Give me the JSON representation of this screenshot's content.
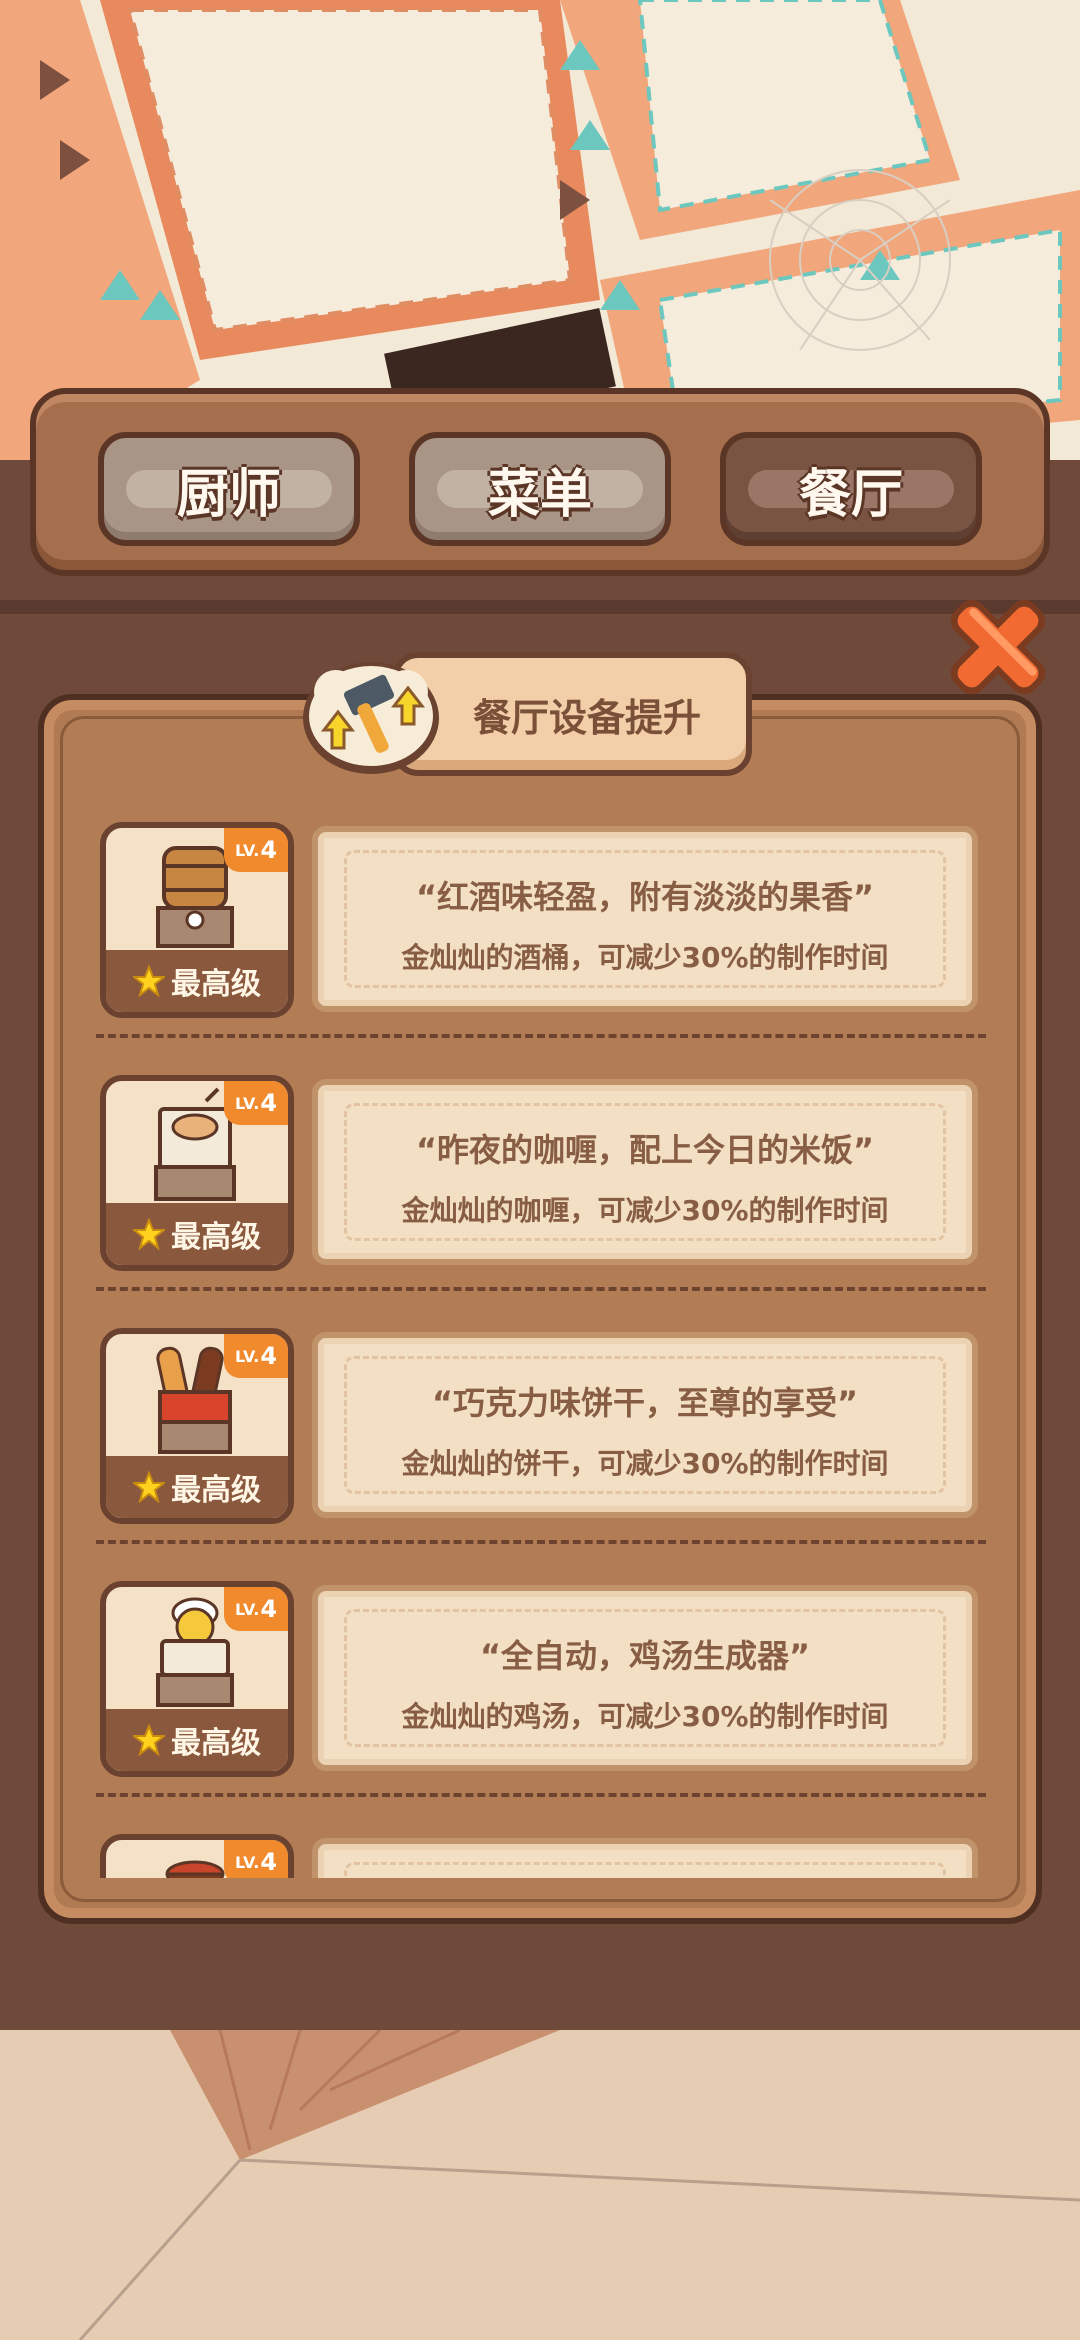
{
  "tabs": [
    {
      "label": "厨师",
      "active": false
    },
    {
      "label": "菜单",
      "active": false
    },
    {
      "label": "餐厅",
      "active": true
    }
  ],
  "panel": {
    "title": "餐厅设备提升",
    "badge_icon": "hammer-upgrade-icon"
  },
  "close_icon": "close-x-icon",
  "equipment": [
    {
      "icon": "wine-barrel-icon",
      "level": "4",
      "level_prefix": "LV.",
      "tier": "最高级",
      "quote": "“红酒味轻盈，附有淡淡的果香”",
      "effect": "金灿灿的酒桶，可减少30%的制作时间"
    },
    {
      "icon": "curry-pot-icon",
      "level": "4",
      "level_prefix": "LV.",
      "tier": "最高级",
      "quote": "“昨夜的咖喱，配上今日的米饭”",
      "effect": "金灿灿的咖喱，可减少30%的制作时间"
    },
    {
      "icon": "cookie-stand-icon",
      "level": "4",
      "level_prefix": "LV.",
      "tier": "最高级",
      "quote": "“巧克力味饼干，至尊的享受”",
      "effect": "金灿灿的饼干，可减少30%的制作时间"
    },
    {
      "icon": "soup-machine-icon",
      "level": "4",
      "level_prefix": "LV.",
      "tier": "最高级",
      "quote": "“全自动，鸡汤生成器”",
      "effect": "金灿灿的鸡汤，可减少30%的制作时间"
    },
    {
      "icon": "stew-pot-icon",
      "level": "4",
      "level_prefix": "LV.",
      "tier": "",
      "quote": "",
      "effect": ""
    }
  ],
  "colors": {
    "accent_orange": "#f08a2c",
    "wood_dark": "#5b3626",
    "star_yellow": "#ffd21e",
    "close_red": "#ee5a2a"
  }
}
